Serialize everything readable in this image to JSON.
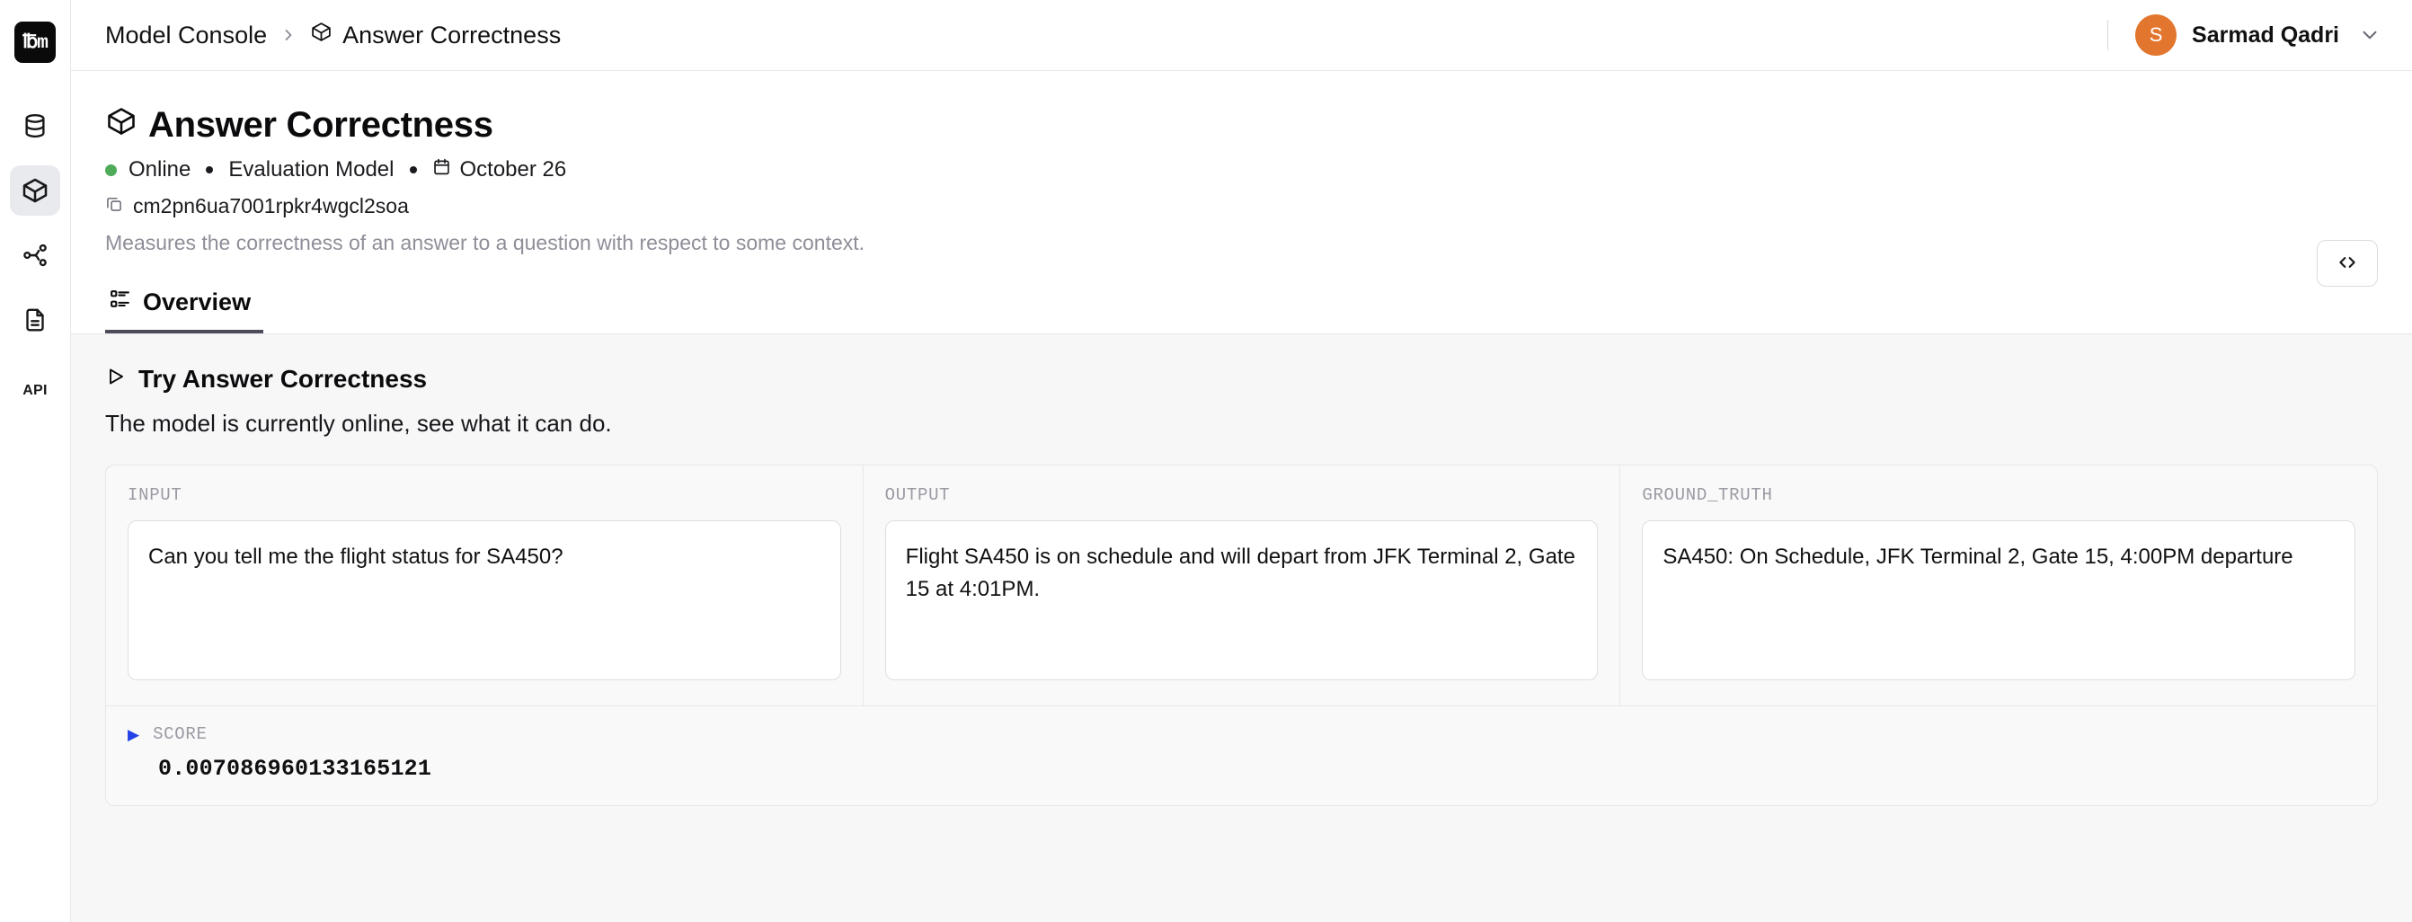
{
  "brand": {
    "logo_text": "℔m",
    "logo_bg": "#0a0a0a"
  },
  "rail": {
    "items": [
      {
        "name": "database-icon",
        "label": "Datasets"
      },
      {
        "name": "cube-icon",
        "label": "Models",
        "active": true
      },
      {
        "name": "branch-icon",
        "label": "Workflows"
      },
      {
        "name": "document-icon",
        "label": "Documents"
      }
    ],
    "api_label": "API"
  },
  "topbar": {
    "breadcrumb": {
      "root": "Model Console",
      "separator": "›",
      "current": "Answer Correctness"
    },
    "user": {
      "initial": "S",
      "name": "Sarmad Qadri",
      "avatar_color": "#e2762e"
    }
  },
  "header": {
    "title": "Answer Correctness",
    "status": "Online",
    "status_color": "#4eab5a",
    "type": "Evaluation Model",
    "date": "October 26",
    "id": "cm2pn6ua7001rpkr4wgcl2soa",
    "description": "Measures the correctness of an answer to a question with respect to some context.",
    "code_button_label": "</>"
  },
  "tabs": [
    {
      "label": "Overview",
      "icon": "list-icon",
      "active": true
    }
  ],
  "try_section": {
    "heading": "Try Answer Correctness",
    "subheading": "The model is currently online, see what it can do.",
    "columns": [
      {
        "label": "INPUT",
        "value": "Can you tell me the flight status for SA450?"
      },
      {
        "label": "OUTPUT",
        "value": "Flight SA450 is on schedule and will depart from JFK Terminal 2, Gate 15 at 4:01PM."
      },
      {
        "label": "GROUND_TRUTH",
        "value": "SA450: On Schedule, JFK Terminal 2, Gate 15, 4:00PM departure"
      }
    ],
    "score": {
      "label": "SCORE",
      "value": "0.007086960133165121",
      "toggle_color": "#2342e8"
    }
  }
}
